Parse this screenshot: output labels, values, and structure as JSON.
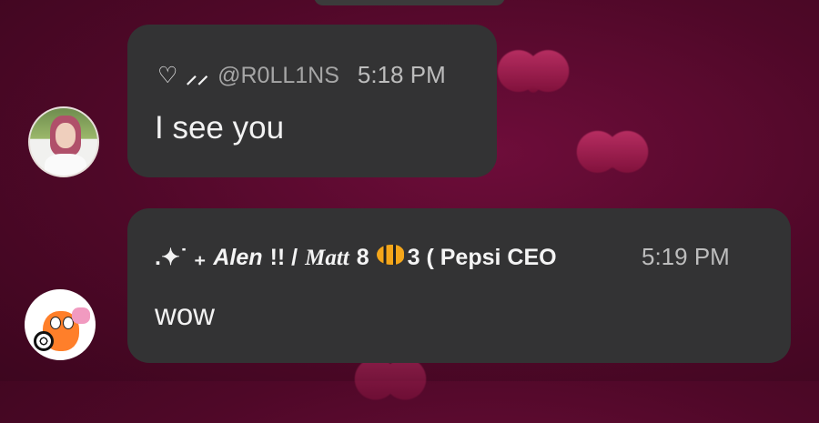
{
  "messages": [
    {
      "display_prefix": "♡ ⸝⸝",
      "username": "@R0LL1NS",
      "time": "5:18 PM",
      "text": "I see you"
    },
    {
      "name_sparkle": ".✦˙ ₊",
      "name_part1": "Alen",
      "name_part2": "!! /",
      "name_part3": "Matt",
      "name_part4": "8",
      "name_part5": "3 ( Pepsi CEO",
      "time": "5:19 PM",
      "text": "wow"
    }
  ],
  "icons": {
    "avatar_1": "girl-avatar",
    "avatar_2": "cartoon-avatar",
    "fish_emoji": "tropical-fish-icon",
    "background": "floating-hearts"
  },
  "colors": {
    "background": "#4f0828",
    "bubble": "#333334",
    "timestamp": "#bdbdbd"
  }
}
